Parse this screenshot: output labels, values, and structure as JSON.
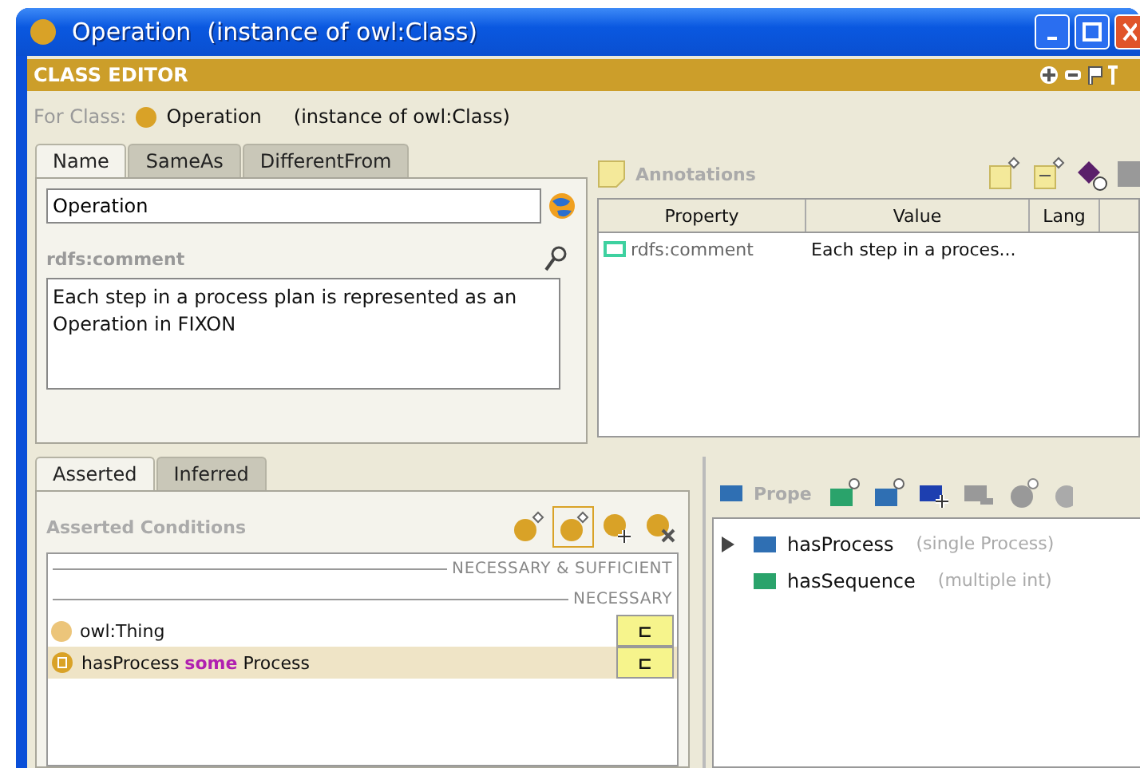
{
  "window": {
    "title": "Operation",
    "subtitle": "(instance of owl:Class)"
  },
  "editor": {
    "title": "CLASS EDITOR",
    "for_label": "For Class:",
    "class_name": "Operation",
    "class_type": "(instance of owl:Class)"
  },
  "name_tabs": [
    {
      "label": "Name",
      "selected": true
    },
    {
      "label": "SameAs",
      "selected": false
    },
    {
      "label": "DifferentFrom",
      "selected": false
    }
  ],
  "name_field": {
    "value": "Operation"
  },
  "comment": {
    "label": "rdfs:comment",
    "text": "Each step in a process plan is represented as an Operation in FIXON"
  },
  "annotations": {
    "title": "Annotations",
    "columns": [
      "Property",
      "Value",
      "Lang"
    ],
    "rows": [
      {
        "property": "rdfs:comment",
        "value": "Each step in a proces..."
      }
    ]
  },
  "condition_tabs": [
    {
      "label": "Asserted",
      "selected": true
    },
    {
      "label": "Inferred",
      "selected": false
    }
  ],
  "conditions": {
    "title": "Asserted Conditions",
    "items": [
      {
        "kind": "section",
        "text": "NECESSARY & SUFFICIENT"
      },
      {
        "kind": "section",
        "text": "NECESSARY"
      },
      {
        "kind": "class",
        "text": "owl:Thing",
        "marker": "⊏",
        "selected": false
      },
      {
        "kind": "restriction",
        "property": "hasProcess",
        "quantifier": "some",
        "filler": "Process",
        "marker": "⊏",
        "selected": true
      }
    ]
  },
  "properties": {
    "title": "Prope",
    "items": [
      {
        "kind": "object",
        "name": "hasProcess",
        "detail": "(single Process)",
        "has_children": true
      },
      {
        "kind": "datatype",
        "name": "hasSequence",
        "detail": "(multiple int)",
        "has_children": false
      }
    ]
  }
}
